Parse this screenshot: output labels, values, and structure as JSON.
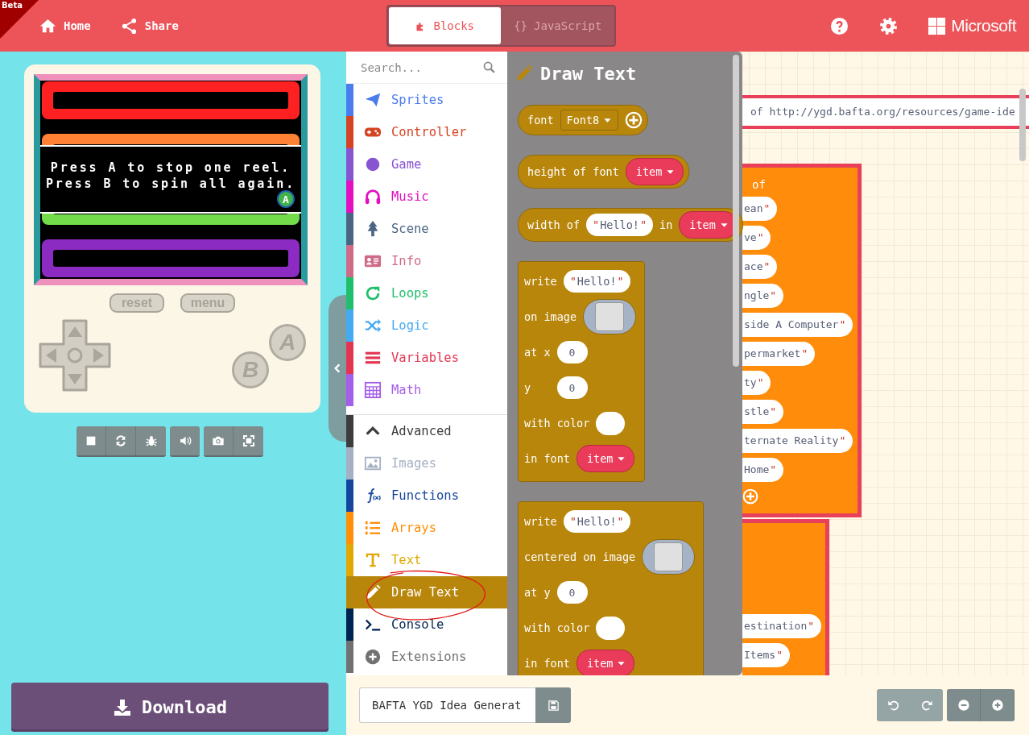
{
  "header": {
    "badge": "Beta",
    "nav": [
      {
        "kind": "home",
        "label": "Home"
      },
      {
        "kind": "share",
        "label": "Share"
      }
    ],
    "tabs": [
      {
        "kind": "blocks",
        "label": "Blocks",
        "selected": true
      },
      {
        "kind": "code",
        "glyph": "{}",
        "label": "JavaScript",
        "selected": false
      }
    ],
    "actions": [
      {
        "kind": "help"
      },
      {
        "kind": "settings"
      }
    ],
    "brand": "Microsoft"
  },
  "simulator": {
    "reels": [
      {
        "color": "#ff2121"
      },
      {
        "color": "#ff8135"
      },
      {
        "color": "#72dc4a"
      },
      {
        "color": "#8c2bc2"
      }
    ],
    "dialog_lines": [
      "Press A to stop one reel.",
      "Press B to spin all again."
    ],
    "dialog_badge": "A",
    "menu_buttons": [
      "reset",
      "menu"
    ],
    "buttons": [
      {
        "kind": "b",
        "label": "B"
      },
      {
        "kind": "a",
        "label": "A"
      }
    ],
    "toolbar": [
      [
        {
          "kind": "stop"
        },
        {
          "kind": "restart"
        },
        {
          "kind": "debug"
        }
      ],
      [
        {
          "kind": "sound"
        }
      ],
      [
        {
          "kind": "screenshot"
        },
        {
          "kind": "fullscreen"
        }
      ]
    ],
    "download": "Download"
  },
  "toolbox": {
    "search": {
      "placeholder": "Search..."
    },
    "groups": [
      [
        {
          "kind": "sprites",
          "label": "Sprites",
          "color": "#4b7bec",
          "selected": false
        },
        {
          "kind": "controller",
          "label": "Controller",
          "color": "#d54322",
          "selected": false
        },
        {
          "kind": "game",
          "label": "Game",
          "color": "#8854d0",
          "selected": false
        },
        {
          "kind": "music",
          "label": "Music",
          "color": "#e30fc0",
          "selected": false
        },
        {
          "kind": "scene",
          "label": "Scene",
          "color": "#4b6584",
          "selected": false
        },
        {
          "kind": "info",
          "label": "Info",
          "color": "#cf6a87",
          "selected": false
        },
        {
          "kind": "loops",
          "label": "Loops",
          "color": "#20bf6b",
          "selected": false
        },
        {
          "kind": "logic",
          "label": "Logic",
          "color": "#45aaf2",
          "selected": false
        },
        {
          "kind": "variables",
          "label": "Variables",
          "color": "#e33652",
          "selected": false
        },
        {
          "kind": "math",
          "label": "Math",
          "color": "#a55eea",
          "selected": false
        }
      ],
      [
        {
          "kind": "advanced",
          "label": "Advanced",
          "color": "#3c3c3c",
          "selected": false
        },
        {
          "kind": "images",
          "label": "Images",
          "color": "#a5b1c2",
          "selected": false
        },
        {
          "kind": "functions",
          "label": "Functions",
          "color": "#1446a0",
          "selected": false
        },
        {
          "kind": "arrays",
          "label": "Arrays",
          "color": "#ff8f08",
          "selected": false
        },
        {
          "kind": "text",
          "label": "Text",
          "color": "#e0a800",
          "selected": false
        },
        {
          "kind": "drawtext",
          "label": "Draw Text",
          "color": "#b8860b",
          "selected": true
        },
        {
          "kind": "console",
          "label": "Console",
          "color": "#002451",
          "selected": false
        },
        {
          "kind": "extensions",
          "label": "Extensions",
          "color": "#717171",
          "selected": false
        }
      ]
    ]
  },
  "flyout": {
    "title": "Draw Text",
    "quote": "\"",
    "blocks": [
      {
        "kind": "reporter",
        "rows": [
          [
            {
              "kind": "label",
              "text": "font"
            },
            {
              "kind": "dropdown",
              "text": "Font8"
            },
            {
              "kind": "add"
            }
          ]
        ]
      },
      {
        "kind": "reporter",
        "rows": [
          [
            {
              "kind": "label",
              "text": "height of font"
            },
            {
              "kind": "enum",
              "text": "item"
            }
          ]
        ]
      },
      {
        "kind": "reporter",
        "rows": [
          [
            {
              "kind": "label",
              "text": "width of"
            },
            {
              "kind": "string",
              "text": "Hello!"
            },
            {
              "kind": "label",
              "text": "in"
            },
            {
              "kind": "enum",
              "text": "item"
            }
          ]
        ]
      },
      {
        "kind": "statement",
        "rows": [
          [
            {
              "kind": "label",
              "text": "write"
            },
            {
              "kind": "string",
              "text": "Hello!"
            }
          ],
          [
            {
              "kind": "label",
              "text": "on image"
            },
            {
              "kind": "image"
            }
          ],
          [
            {
              "kind": "label",
              "text": "at x"
            },
            {
              "kind": "number",
              "text": "0"
            }
          ],
          [
            {
              "kind": "label",
              "text": "y"
            },
            {
              "kind": "number",
              "text": "0"
            }
          ],
          [
            {
              "kind": "label",
              "text": "with color"
            },
            {
              "kind": "color"
            }
          ],
          [
            {
              "kind": "label",
              "text": "in font"
            },
            {
              "kind": "enum",
              "text": "item"
            }
          ]
        ]
      },
      {
        "kind": "statement",
        "rows": [
          [
            {
              "kind": "label",
              "text": "write"
            },
            {
              "kind": "string",
              "text": "Hello!"
            }
          ],
          [
            {
              "kind": "label",
              "text": "centered on image"
            },
            {
              "kind": "image"
            }
          ],
          [
            {
              "kind": "label",
              "text": "at y"
            },
            {
              "kind": "number",
              "text": "0"
            }
          ],
          [
            {
              "kind": "label",
              "text": "with color"
            },
            {
              "kind": "color"
            }
          ],
          [
            {
              "kind": "label",
              "text": "in font"
            },
            {
              "kind": "enum",
              "text": "item"
            }
          ]
        ]
      }
    ]
  },
  "workspace": {
    "quote": "\"",
    "comment": "of http://ygd.bafta.org/resources/game-ide",
    "arrays": [
      {
        "header": "of",
        "items": [
          "ean",
          "ve",
          "ace",
          "ngle",
          "side A Computer",
          "permarket",
          "ty",
          "stle",
          "ternate Reality",
          "Home"
        ],
        "add": true
      },
      {
        "items": [
          "estination",
          "Items"
        ],
        "add": false
      }
    ]
  },
  "annotation": {
    "kind": "ellipse"
  },
  "footer": {
    "project_name": "BAFTA YGD Idea Generat",
    "history": [
      {
        "kind": "undo"
      },
      {
        "kind": "redo"
      }
    ],
    "zoom": [
      {
        "kind": "zoom-out"
      },
      {
        "kind": "zoom-in"
      }
    ]
  }
}
